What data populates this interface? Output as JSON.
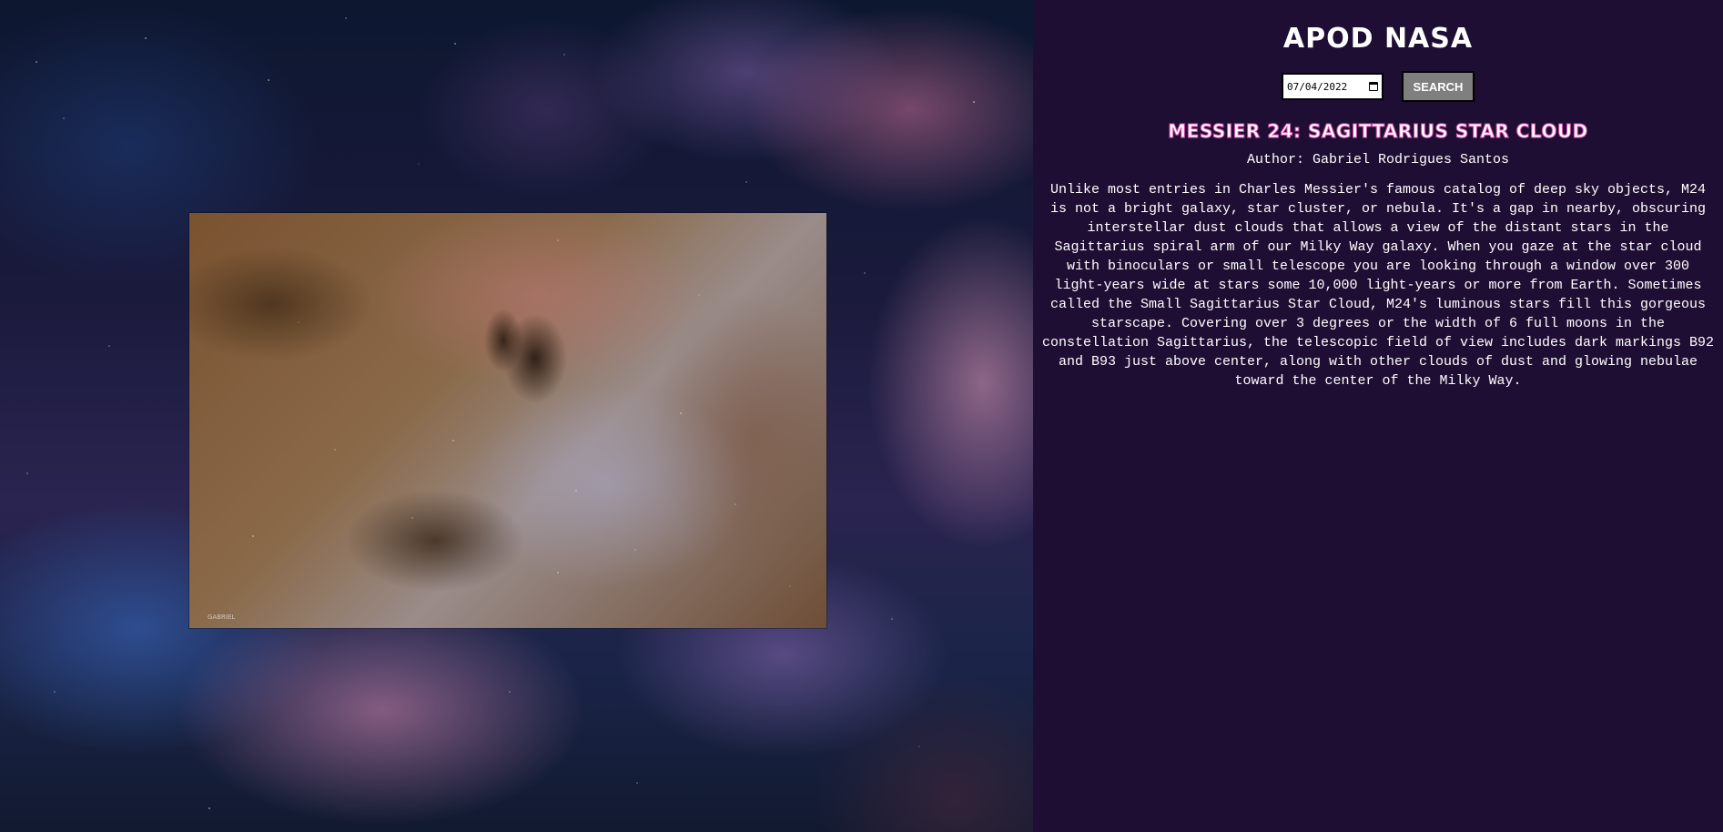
{
  "app": {
    "title": "APOD NASA"
  },
  "search": {
    "date_value": "07/04/2022",
    "button_label": "SEARCH"
  },
  "apod": {
    "title": "MESSIER 24: SAGITTARIUS STAR CLOUD",
    "author": "Author: Gabriel Rodrigues Santos",
    "explanation": "Unlike most entries in Charles Messier's famous catalog of deep sky objects, M24 is not a bright galaxy, star cluster, or nebula. It's a gap in nearby, obscuring interstellar dust clouds that allows a view of the distant stars in the Sagittarius spiral arm of our Milky Way galaxy. When you gaze at the star cloud with binoculars or small telescope you are looking through a window over 300 light-years wide at stars some 10,000 light-years or more from Earth. Sometimes called the Small Sagittarius Star Cloud, M24's luminous stars fill this gorgeous starscape. Covering over 3 degrees or the width of 6 full moons in the constellation Sagittarius, the telescopic field of view includes dark markings B92 and B93 just above center, along with other clouds of dust and glowing nebulae toward the center of the Milky Way.",
    "image_credit": "GABRIEL"
  },
  "colors": {
    "panel_background": "#1f0e33",
    "title_outline": "#d94fb2",
    "button_background": "#7f7f7f"
  }
}
